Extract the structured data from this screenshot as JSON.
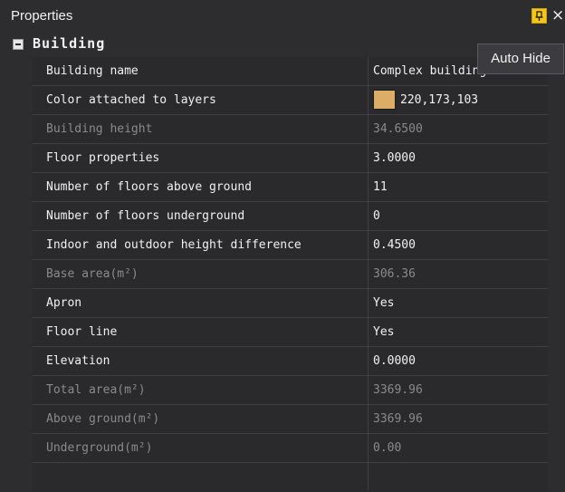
{
  "panel": {
    "title": "Properties",
    "tooltip": "Auto Hide",
    "close_glyph": "×",
    "pin_icon": "pin-icon",
    "close_icon": "close-icon"
  },
  "category": {
    "label": "Building",
    "expanded": true
  },
  "properties": [
    {
      "name": "Building name",
      "value": "Complex building",
      "readonly": false
    },
    {
      "name": "Color attached to layers",
      "value": "220,173,103",
      "readonly": false,
      "swatch": "#dcad67"
    },
    {
      "name": "Building height",
      "value": "34.6500",
      "readonly": true
    },
    {
      "name": "Floor properties",
      "value": "3.0000",
      "readonly": false
    },
    {
      "name": "Number of floors above ground",
      "value": "11",
      "readonly": false
    },
    {
      "name": "Number of floors underground",
      "value": "0",
      "readonly": false
    },
    {
      "name": "Indoor and outdoor height difference",
      "value": "0.4500",
      "readonly": false
    },
    {
      "name": "Base area(m²)",
      "value": "306.36",
      "readonly": true
    },
    {
      "name": "Apron",
      "value": "Yes",
      "readonly": false
    },
    {
      "name": "Floor line",
      "value": "Yes",
      "readonly": false
    },
    {
      "name": "Elevation",
      "value": "0.0000",
      "readonly": false
    },
    {
      "name": "Total area(m²)",
      "value": "3369.96",
      "readonly": true
    },
    {
      "name": "Above ground(m²)",
      "value": "3369.96",
      "readonly": true
    },
    {
      "name": "Underground(m²)",
      "value": "0.00",
      "readonly": true
    }
  ],
  "colors": {
    "background": "#2d2d30",
    "grid_background": "#2a2a2c",
    "grid_line": "#3f3f46",
    "text": "#f1f1f1",
    "readonly_text": "#8a8a8a",
    "pin_accent": "#f5c518"
  }
}
